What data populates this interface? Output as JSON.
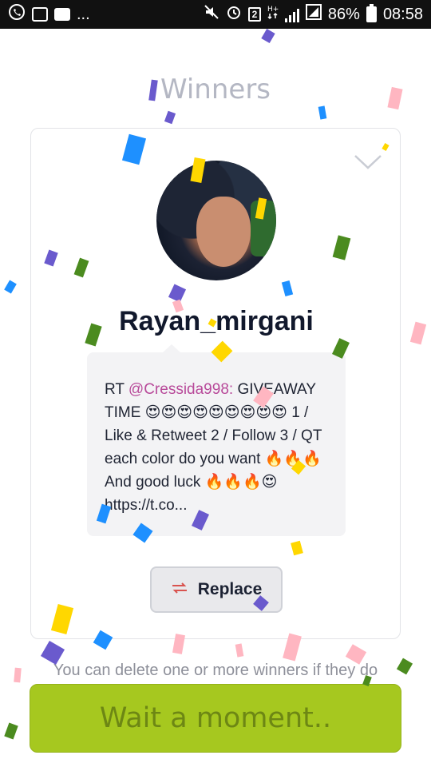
{
  "status_bar": {
    "left_icons": [
      "whatsapp-icon",
      "gallery-icon",
      "message-icon"
    ],
    "more": "...",
    "right_icons": [
      "mute-icon",
      "alarm-icon",
      "sim-icon",
      "network-type-icon",
      "signal-icon",
      "signal-boxed-icon"
    ],
    "sim_label": "2",
    "battery_percent": "86%",
    "time": "08:58"
  },
  "page": {
    "title": "Winners"
  },
  "winner_card": {
    "username": "Rayan_mirgani",
    "tweet": {
      "prefix": "RT ",
      "mention": "@Cressida998:",
      "text": " GIVEAWAY TIME 😍😍😍😍😍😍😍😍😍 1 / Like & Retweet 2 / Follow 3 / QT each color do you want 🔥🔥🔥 And good luck 🔥🔥🔥😍 https://t.co..."
    },
    "replace_label": "Replace"
  },
  "hint": "You can delete one or more winners if they do",
  "wait_button": "Wait a moment..",
  "colors": {
    "accent": "#a6c81f",
    "title": "#b4b7c3",
    "mention": "#b84a9a",
    "confetti": [
      "#6a5acd",
      "#1e90ff",
      "#ffd700",
      "#ffb6c1",
      "#4b8b1f"
    ]
  }
}
